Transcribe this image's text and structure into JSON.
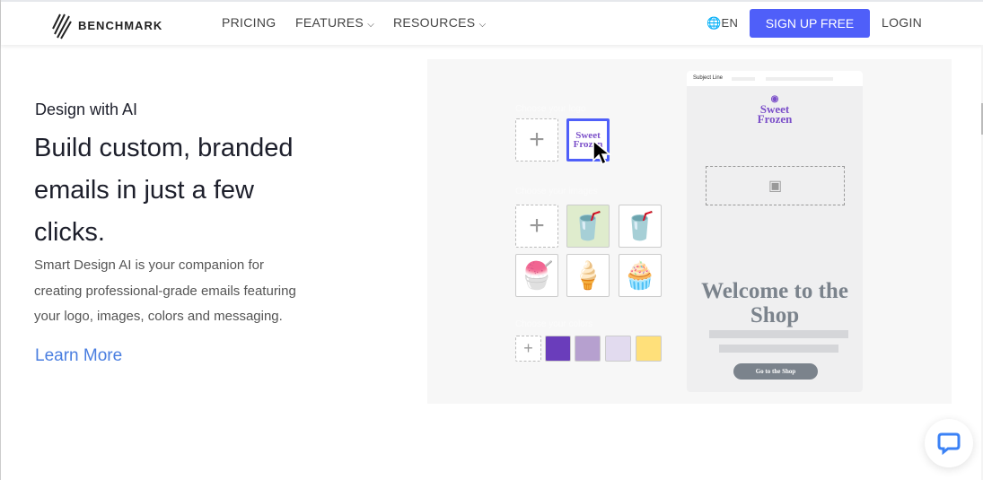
{
  "nav": {
    "brand": "BENCHMARK",
    "links": [
      "PRICING",
      "FEATURES",
      "RESOURCES"
    ],
    "language": "EN",
    "signup": "SIGN UP FREE",
    "login": "LOGIN"
  },
  "hero": {
    "eyebrow": "Design with AI",
    "headline": "Build custom, branded emails in just a few clicks.",
    "body": "Smart Design AI is your companion for creating professional-grade emails featuring your logo, images, colors and messaging.",
    "cta": "Learn More"
  },
  "builder": {
    "logo_label": "Choose your logo",
    "images_label": "Choose your images",
    "colors_label": "Choose your colors",
    "logo_text": "Sweet Frozen",
    "colors": [
      "#6a3dbb",
      "#b6a0cf",
      "#e2dbef",
      "#ffe07a"
    ],
    "accent": "#4f5ff9"
  },
  "email": {
    "subject_label": "Subject Line",
    "brand": "Sweet Frozen",
    "headline": "Welcome to the Shop",
    "button": "Go to the Shop"
  }
}
